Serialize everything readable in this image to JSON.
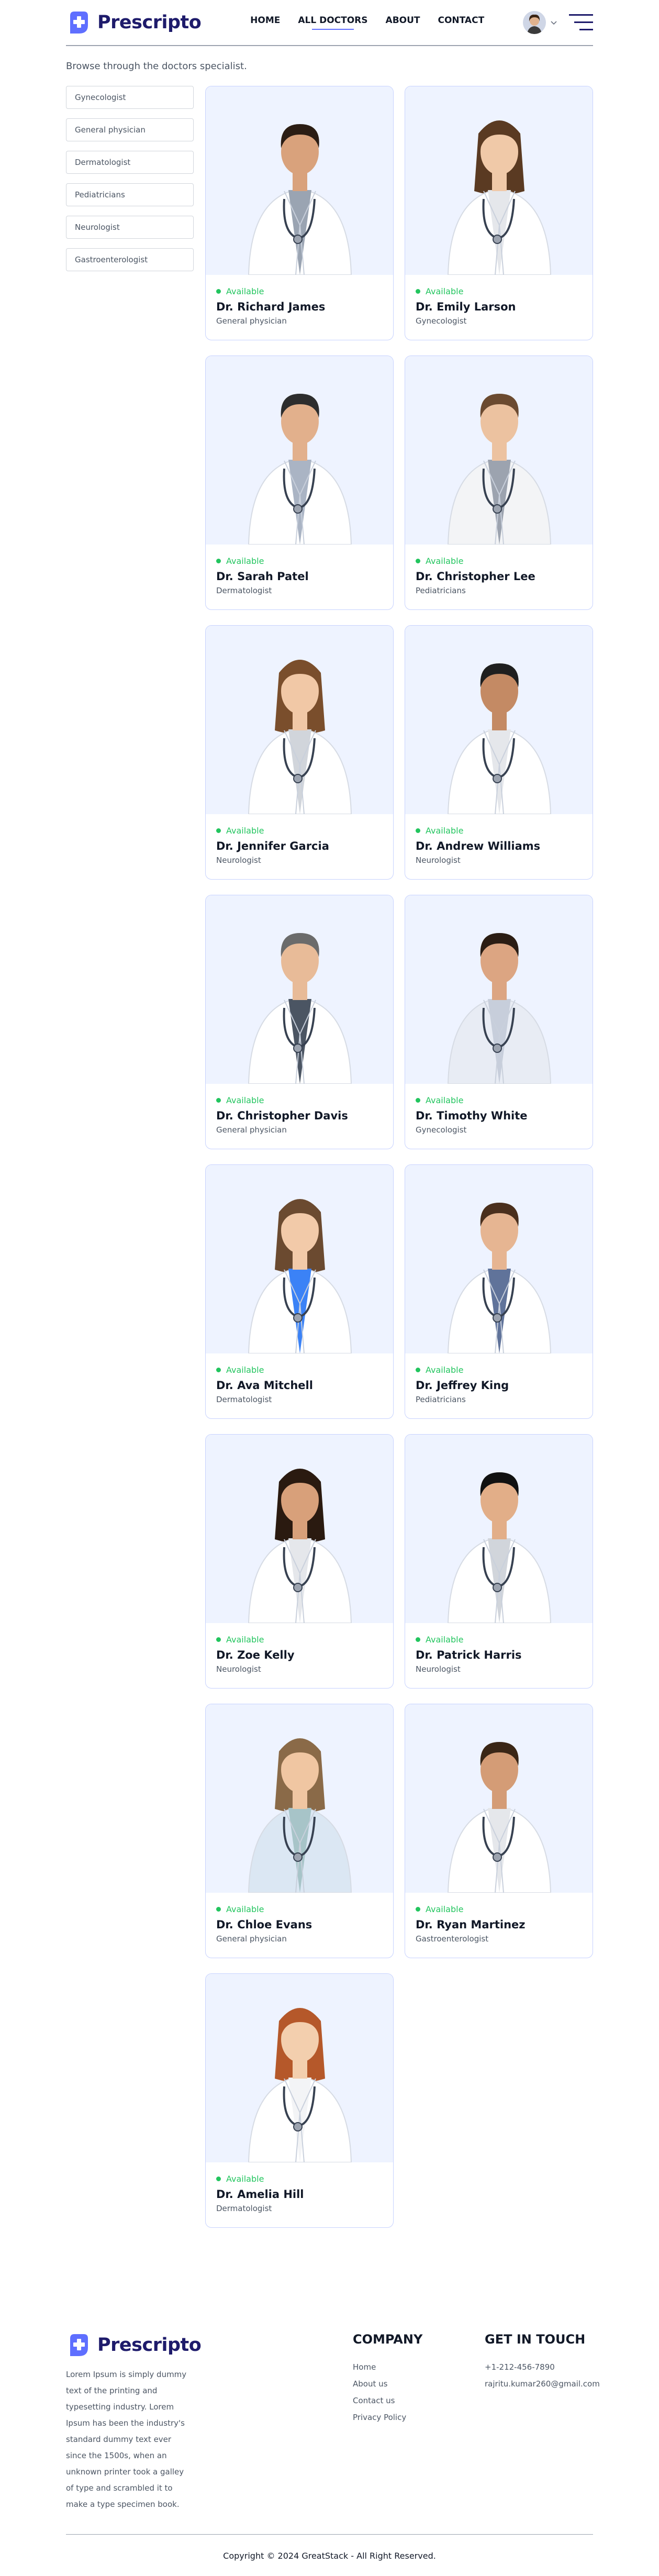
{
  "brand": {
    "name": "Prescripto"
  },
  "nav": {
    "links": [
      {
        "label": "HOME",
        "active": false
      },
      {
        "label": "ALL DOCTORS",
        "active": true
      },
      {
        "label": "ABOUT",
        "active": false
      },
      {
        "label": "CONTACT",
        "active": false
      }
    ]
  },
  "intro": "Browse through the doctors specialist.",
  "filters": [
    "Gynecologist",
    "General physician",
    "Dermatologist",
    "Pediatricians",
    "Neurologist",
    "Gastroenterologist"
  ],
  "doctors": [
    {
      "status": "Available",
      "name": "Dr. Richard James",
      "speciality": "General physician"
    },
    {
      "status": "Available",
      "name": "Dr. Emily Larson",
      "speciality": "Gynecologist"
    },
    {
      "status": "Available",
      "name": "Dr. Sarah Patel",
      "speciality": "Dermatologist"
    },
    {
      "status": "Available",
      "name": "Dr. Christopher Lee",
      "speciality": "Pediatricians"
    },
    {
      "status": "Available",
      "name": "Dr. Jennifer Garcia",
      "speciality": "Neurologist"
    },
    {
      "status": "Available",
      "name": "Dr. Andrew Williams",
      "speciality": "Neurologist"
    },
    {
      "status": "Available",
      "name": "Dr. Christopher Davis",
      "speciality": "General physician"
    },
    {
      "status": "Available",
      "name": "Dr. Timothy White",
      "speciality": "Gynecologist"
    },
    {
      "status": "Available",
      "name": "Dr. Ava Mitchell",
      "speciality": "Dermatologist"
    },
    {
      "status": "Available",
      "name": "Dr. Jeffrey King",
      "speciality": "Pediatricians"
    },
    {
      "status": "Available",
      "name": "Dr. Zoe Kelly",
      "speciality": "Neurologist"
    },
    {
      "status": "Available",
      "name": "Dr. Patrick Harris",
      "speciality": "Neurologist"
    },
    {
      "status": "Available",
      "name": "Dr. Chloe Evans",
      "speciality": "General physician"
    },
    {
      "status": "Available",
      "name": "Dr. Ryan Martinez",
      "speciality": "Gastroenterologist"
    },
    {
      "status": "Available",
      "name": "Dr. Amelia Hill",
      "speciality": "Dermatologist"
    }
  ],
  "footer": {
    "description": "Lorem Ipsum is simply dummy text of the printing and typesetting industry. Lorem Ipsum has been the industry's standard dummy text ever since the 1500s, when an unknown printer took a galley of type and scrambled it to make a type specimen book.",
    "company": {
      "title": "COMPANY",
      "links": [
        "Home",
        "About us",
        "Contact us",
        "Privacy Policy"
      ]
    },
    "contact": {
      "title": "GET IN TOUCH",
      "items": [
        "+1-212-456-7890",
        "rajritu.kumar260@gmail.com"
      ]
    },
    "copyright": "Copyright © 2024 GreatStack - All Right Reserved."
  },
  "colors": {
    "primary": "#5f6fff",
    "brand_text": "#1e1b6b",
    "available": "#22c55e",
    "card_bg": "#eef3ff"
  },
  "icons": {
    "logo": "medical-cross-icon",
    "menu": "hamburger-menu-icon",
    "dropdown": "chevron-down-icon"
  }
}
